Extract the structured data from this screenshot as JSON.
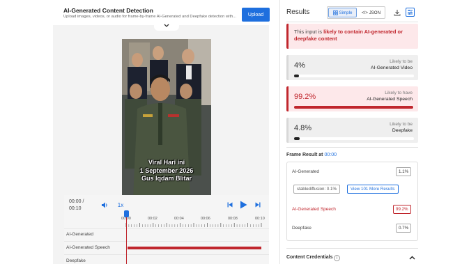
{
  "header": {
    "title": "AI-Generated Content Detection",
    "subtitle": "Upload images, videos, or audio for frame-by-frame AI-Generated and Deepfake detection with...",
    "upload_label": "Upload"
  },
  "video": {
    "caption_lines": [
      "Viral Hari ini",
      "1 September 2026",
      "Gus Iqdam Blitar"
    ]
  },
  "player": {
    "time_current": "00:00 /",
    "time_total": "00:10",
    "speed": "1x",
    "ticks": [
      "00:00",
      "00:02",
      "00:04",
      "00:06",
      "00:08",
      "00:10"
    ],
    "tracks": [
      "AI-Generated",
      "AI-Generated Speech",
      "Deepfake"
    ]
  },
  "results": {
    "title": "Results",
    "view_simple": "Simple",
    "view_json": "</> JSON",
    "alert_prefix": "This input is ",
    "alert_emphasis": "likely to contain AI-generated or deepfake content",
    "cards": [
      {
        "pct": "4%",
        "line1": "Likely to be",
        "line2": "AI-Generated Video",
        "value": 0.04,
        "style": "gray"
      },
      {
        "pct": "99.2%",
        "line1": "Likely to have",
        "line2": "AI-Generated Speech",
        "value": 0.992,
        "style": "red"
      },
      {
        "pct": "4.8%",
        "line1": "Likely to be",
        "line2": "Deepfake",
        "value": 0.048,
        "style": "gray"
      }
    ],
    "frame_result_label": "Frame Result at",
    "frame_result_time": "00:00",
    "frame": {
      "ai_generated_label": "AI-Generated",
      "ai_generated_value": "1.1%",
      "chip": "stablediffusion: 0.1%",
      "more_label": "View 101 More Results",
      "speech_label": "AI-Generated Speech",
      "speech_value": "99.2%",
      "deepfake_label": "Deepfake",
      "deepfake_value": "0.7%"
    },
    "credentials_label": "Content Credentials"
  },
  "colors": {
    "accent": "#1e6fde",
    "danger": "#c0262d"
  }
}
